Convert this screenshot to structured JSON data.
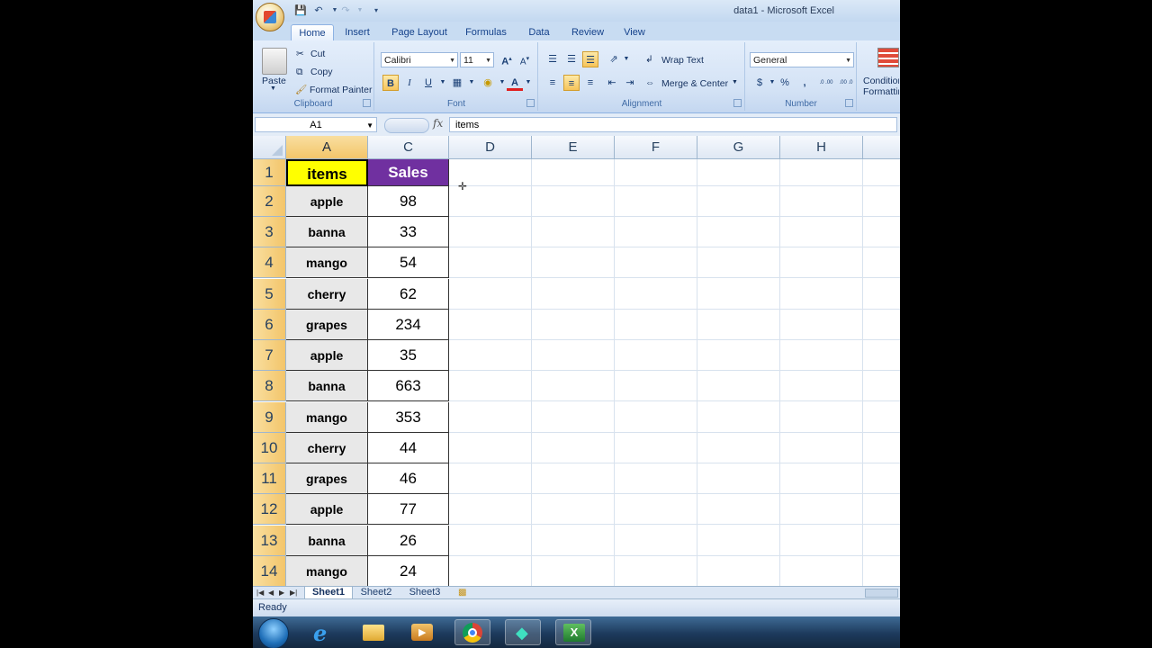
{
  "window": {
    "title": "data1 - Microsoft Excel"
  },
  "ribbon": {
    "tabs": [
      "Home",
      "Insert",
      "Page Layout",
      "Formulas",
      "Data",
      "Review",
      "View"
    ],
    "active_tab": "Home",
    "clipboard": {
      "label": "Clipboard",
      "paste": "Paste",
      "cut": "Cut",
      "copy": "Copy",
      "format_painter": "Format Painter"
    },
    "font": {
      "label": "Font",
      "name": "Calibri",
      "size": "11",
      "bold": "B",
      "italic": "I",
      "underline": "U"
    },
    "alignment": {
      "label": "Alignment",
      "wrap_text": "Wrap Text",
      "merge_center": "Merge & Center"
    },
    "number": {
      "label": "Number",
      "format": "General",
      "currency": "$",
      "percent": "%",
      "comma": ",",
      "inc_decimal": ".0 .00",
      "dec_decimal": ".00 .0"
    },
    "styles": {
      "conditional": "Conditional Formatting"
    }
  },
  "formula_bar": {
    "name_box": "A1",
    "fx": "fx",
    "content": "items"
  },
  "colors": {
    "header_items": "#ffff00",
    "header_sales": "#7030a0",
    "item_cells": "#e8e8e8",
    "selected_header": "#f3c56a"
  },
  "columns": [
    "A",
    "C",
    "D",
    "E",
    "F",
    "G",
    "H"
  ],
  "rows": [
    {
      "n": "1",
      "item": "items",
      "sales": "Sales"
    },
    {
      "n": "2",
      "item": "apple",
      "sales": "98"
    },
    {
      "n": "3",
      "item": "banna",
      "sales": "33"
    },
    {
      "n": "4",
      "item": "mango",
      "sales": "54"
    },
    {
      "n": "5",
      "item": "cherry",
      "sales": "62"
    },
    {
      "n": "6",
      "item": "grapes",
      "sales": "234"
    },
    {
      "n": "7",
      "item": "apple",
      "sales": "35"
    },
    {
      "n": "8",
      "item": "banna",
      "sales": "663"
    },
    {
      "n": "9",
      "item": "mango",
      "sales": "353"
    },
    {
      "n": "10",
      "item": "cherry",
      "sales": "44"
    },
    {
      "n": "11",
      "item": "grapes",
      "sales": "46"
    },
    {
      "n": "12",
      "item": "apple",
      "sales": "77"
    },
    {
      "n": "13",
      "item": "banna",
      "sales": "26"
    },
    {
      "n": "14",
      "item": "mango",
      "sales": "24"
    }
  ],
  "sheets": [
    "Sheet1",
    "Sheet2",
    "Sheet3"
  ],
  "active_sheet": "Sheet1",
  "status": "Ready",
  "taskbar": [
    "start-orb",
    "internet-explorer-icon",
    "file-explorer-icon",
    "media-player-icon",
    "chrome-icon",
    "filmora-icon",
    "excel-icon"
  ]
}
